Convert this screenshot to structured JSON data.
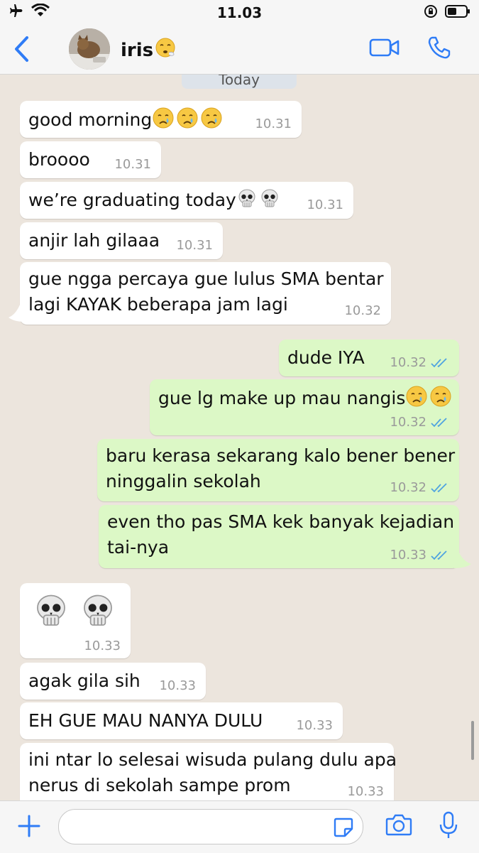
{
  "status_bar": {
    "time": "11.03"
  },
  "header": {
    "contact_name": "iris"
  },
  "chat": {
    "date_label": "Today",
    "messages": [
      {
        "dir": "in",
        "text": "good morning",
        "time": "10.31"
      },
      {
        "dir": "in",
        "text": "broooo",
        "time": "10.31"
      },
      {
        "dir": "in",
        "text": "we’re graduating today",
        "time": "10.31"
      },
      {
        "dir": "in",
        "text": "anjir lah gilaaa",
        "time": "10.31"
      },
      {
        "dir": "in",
        "text_lines": [
          "gue ngga percaya gue lulus SMA bentar",
          "lagi KAYAK beberapa jam lagi"
        ],
        "time": "10.32"
      },
      {
        "dir": "out",
        "text": "dude IYA",
        "time": "10.32",
        "read": true
      },
      {
        "dir": "out",
        "text": "gue lg make up mau nangis",
        "time": "10.32",
        "read": true
      },
      {
        "dir": "out",
        "text_lines": [
          "baru kerasa sekarang kalo bener bener",
          "ninggalin sekolah"
        ],
        "time": "10.32",
        "read": true
      },
      {
        "dir": "out",
        "text_lines": [
          "even tho pas SMA kek banyak kejadian",
          "tai-nya"
        ],
        "time": "10.33",
        "read": true
      },
      {
        "dir": "in",
        "emoji_only": "skull-skull",
        "time": "10.33"
      },
      {
        "dir": "in",
        "text": "agak gila sih",
        "time": "10.33"
      },
      {
        "dir": "in",
        "text": "EH GUE MAU NANYA DULU",
        "time": "10.33"
      },
      {
        "dir": "in",
        "text_lines": [
          "ini ntar lo selesai wisuda pulang dulu apa",
          "nerus di sekolah sampe prom"
        ],
        "time": "10.33"
      }
    ]
  },
  "icons": {
    "status": [
      "airplane-icon",
      "wifi-icon",
      "orientation-lock-icon",
      "battery-icon"
    ],
    "header": [
      "back-chevron-icon",
      "video-call-icon",
      "phone-call-icon"
    ],
    "composer": [
      "plus-icon",
      "sticker-icon",
      "camera-icon",
      "microphone-icon"
    ]
  },
  "colors": {
    "accent": "#2f7cf6",
    "incoming": "#ffffff",
    "outgoing": "#dcf8c6",
    "background": "#ece5dd",
    "read_ticks": "#4fa3e0"
  }
}
